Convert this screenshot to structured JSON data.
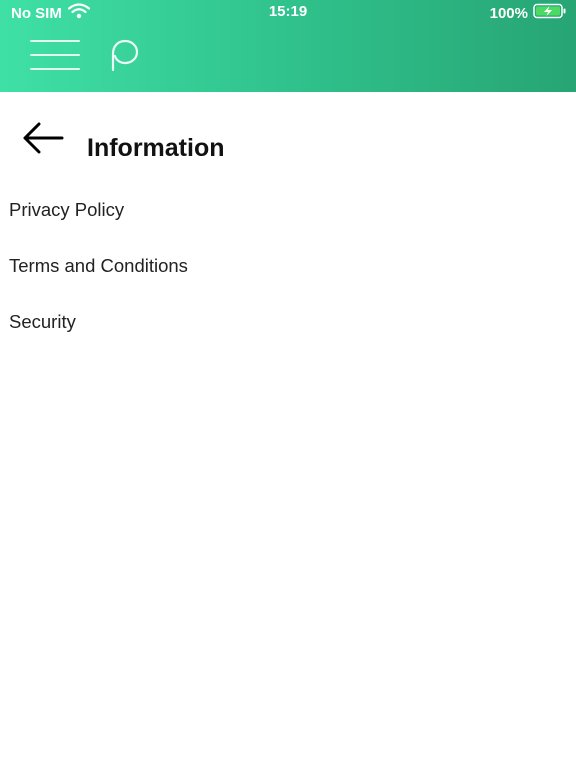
{
  "status_bar": {
    "carrier": "No SIM",
    "time": "15:19",
    "battery": "100%",
    "icons": [
      "wifi-icon",
      "battery-charging-icon"
    ]
  },
  "header": {
    "menu_icon": "hamburger-menu-icon",
    "logo_icon": "p-logo-icon",
    "colors": {
      "gradient_start": "#3fe0a6",
      "gradient_end": "#27a574"
    }
  },
  "page": {
    "back_icon": "back-arrow-icon",
    "title": "Information",
    "items": [
      {
        "label": "Privacy Policy"
      },
      {
        "label": "Terms and Conditions"
      },
      {
        "label": "Security"
      }
    ]
  }
}
